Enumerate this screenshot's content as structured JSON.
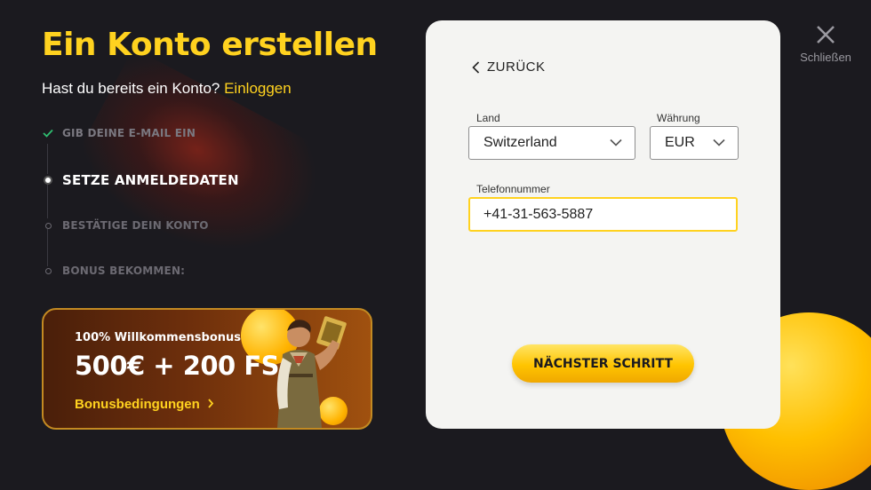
{
  "header": {
    "title": "Ein Konto erstellen",
    "login_prompt": "Hast du bereits ein Konto?",
    "login_link": "Einloggen"
  },
  "steps": [
    {
      "label": "GIB DEINE E-MAIL EIN",
      "status": "done"
    },
    {
      "label": "SETZE ANMELDEDATEN",
      "status": "active"
    },
    {
      "label": "BESTÄTIGE DEIN KONTO",
      "status": "todo"
    },
    {
      "label": "BONUS BEKOMMEN:",
      "status": "todo"
    }
  ],
  "promo": {
    "subtitle": "100% Willkommensbonus",
    "headline": "500€ + 200 FS",
    "terms_link": "Bonusbedingungen"
  },
  "form": {
    "back_label": "ZURÜCK",
    "country_label": "Land",
    "country_value": "Switzerland",
    "currency_label": "Währung",
    "currency_value": "EUR",
    "phone_label": "Telefonnummer",
    "phone_value": "+41-31-563-5887",
    "next_button": "NÄCHSTER SCHRITT"
  },
  "close": {
    "label": "Schließen",
    "icon": "close-icon"
  },
  "colors": {
    "accent": "#ffd21f",
    "background": "#1b1a1f",
    "card": "#f4f4f2",
    "step_done": "#2fbf71"
  }
}
